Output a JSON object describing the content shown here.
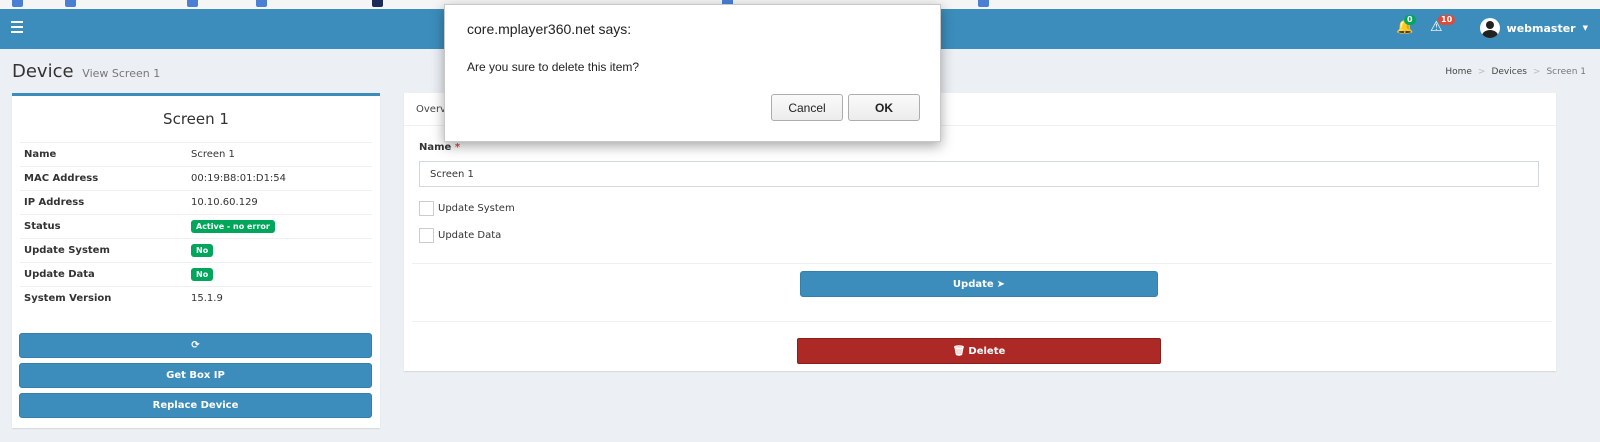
{
  "topbar": {
    "notifications_count": "0",
    "notifications_color": "#00a65a",
    "alerts_count": "10",
    "alerts_color": "#dd4b39",
    "username": "webmaster"
  },
  "header": {
    "title": "Device",
    "subtitle": "View Screen 1",
    "breadcrumb": [
      "Home",
      "Devices",
      "Screen 1"
    ]
  },
  "device_panel": {
    "title": "Screen 1",
    "rows": [
      {
        "key": "Name",
        "value": "Screen 1"
      },
      {
        "key": "MAC Address",
        "value": "00:19:B8:01:D1:54"
      },
      {
        "key": "IP Address",
        "value": "10.10.60.129"
      },
      {
        "key": "Status",
        "value": "Active - no error"
      },
      {
        "key": "Update System",
        "value": "No"
      },
      {
        "key": "Update Data",
        "value": "No"
      },
      {
        "key": "System Version",
        "value": "15.1.9"
      }
    ],
    "refresh_icon": "refresh-icon",
    "get_box_ip_label": "Get Box IP",
    "replace_device_label": "Replace Device"
  },
  "edit_panel": {
    "tab_label": "Overv",
    "name_label": "Name",
    "required_mark": "*",
    "name_value": "Screen 1",
    "update_system_label": "Update System",
    "update_data_label": "Update Data",
    "update_button_label": "Update",
    "update_icon": "arrow-circle-right-icon",
    "delete_button_label": "Delete",
    "delete_icon": "trash-icon"
  },
  "dialog": {
    "title": "core.mplayer360.net says:",
    "message": "Are you sure to delete this item?",
    "cancel_label": "Cancel",
    "ok_label": "OK"
  },
  "colors": {
    "primary": "#3c8dbc",
    "success": "#00a65a",
    "danger": "#ac2925"
  }
}
